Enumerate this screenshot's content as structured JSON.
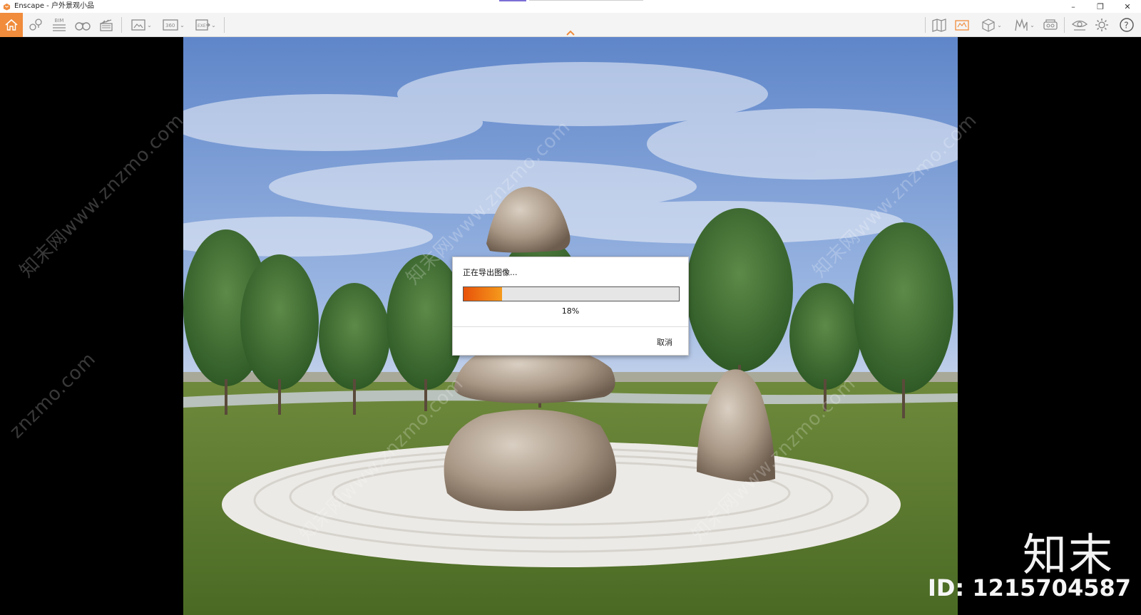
{
  "window": {
    "title": "Enscape - 户外景观小品",
    "minimize": "–",
    "restore": "❐",
    "close": "✕"
  },
  "toolbar": {
    "left_icons": [
      "home-icon",
      "location-icon",
      "bim-icon",
      "binoculars-icon",
      "clapperboard-icon",
      "screenshot-icon",
      "panorama-360-icon",
      "export-exe-icon"
    ],
    "right_icons": [
      "map-icon",
      "asset-library-icon",
      "cube-view-icon",
      "material-icon",
      "vr-headset-icon",
      "visual-settings-icon",
      "settings-gear-icon",
      "help-icon"
    ],
    "bim_label": "BIM",
    "pano_label": "360",
    "exe_label": "EXE",
    "help_label": "?",
    "accent": "#f08c3c"
  },
  "dialog": {
    "title": "正在导出图像...",
    "progress": 0.18,
    "percent_label": "18%",
    "cancel_label": "取消",
    "bar_color_start": "#e8520a",
    "bar_color_end": "#f59a1c"
  },
  "watermark": {
    "text": "知末网www.znzmo.com",
    "text_short": "znzmo.com",
    "brand": "知末",
    "brand_id": "ID: 1215704587"
  }
}
